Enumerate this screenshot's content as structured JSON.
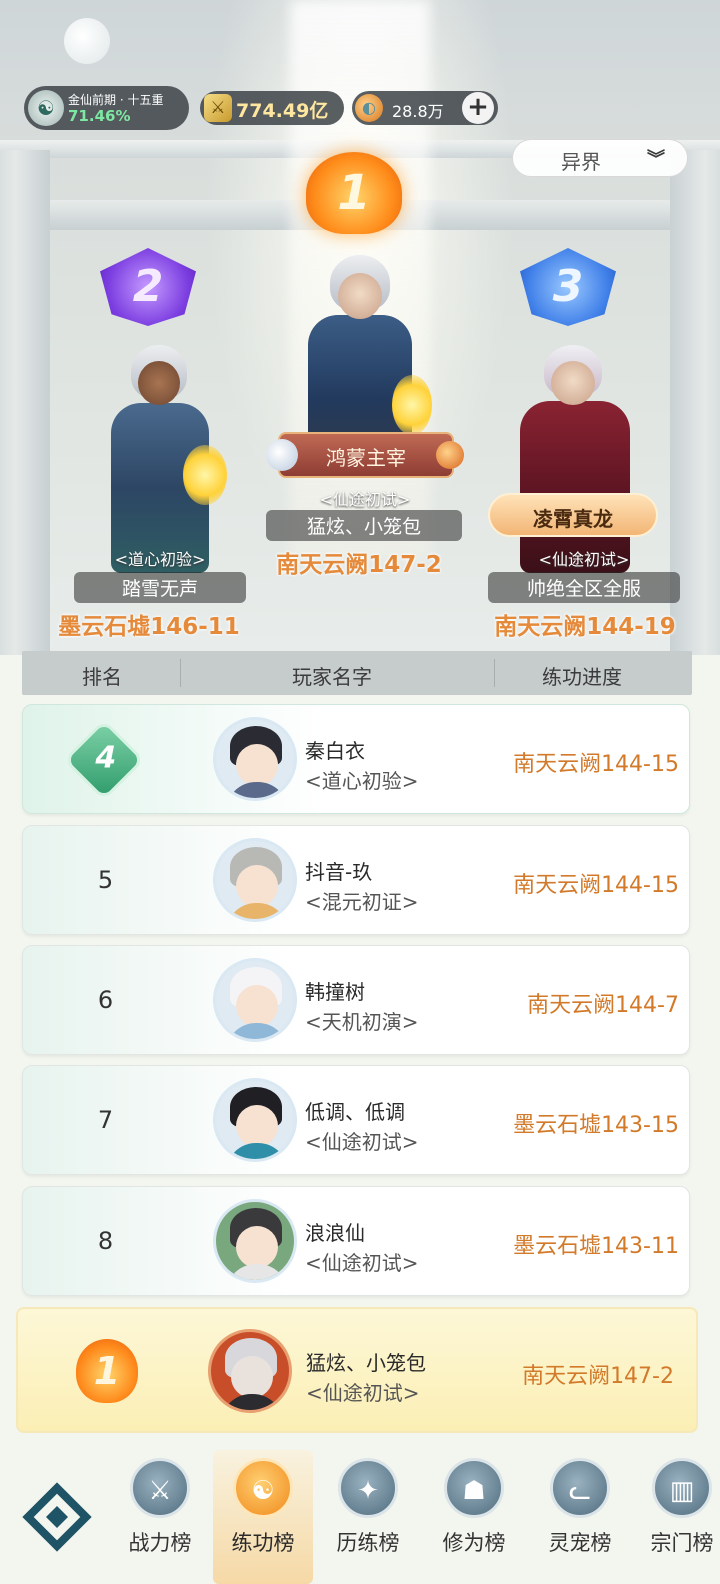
{
  "status_bar": {
    "realm_name": "金仙前期 · 十五重",
    "realm_progress": "71.46%",
    "power": "774.49亿",
    "currency": "28.8万",
    "add_label": "+"
  },
  "realm_select": {
    "value": "异界"
  },
  "podium": {
    "first": {
      "rank": "1",
      "title": "鸿蒙主宰",
      "tier": "<仙途初试>",
      "name": "猛炫、小笼包",
      "server": "南天云阙147-2"
    },
    "second": {
      "rank": "2",
      "tier": "<道心初验>",
      "name": "踏雪无声",
      "server": "墨云石墟146-11"
    },
    "third": {
      "rank": "3",
      "title": "凌霄真龙",
      "tier": "<仙途初试>",
      "name": "帅绝全区全服",
      "server": "南天云阙144-19"
    }
  },
  "table": {
    "headers": [
      "排名",
      "玩家名字",
      "练功进度"
    ],
    "rows": [
      {
        "rank": "4",
        "name": "秦白衣",
        "tier": "<道心初验>",
        "progress": "南天云阙144-15"
      },
      {
        "rank": "5",
        "name": "抖音-玖",
        "tier": "<混元初证>",
        "progress": "南天云阙144-15"
      },
      {
        "rank": "6",
        "name": "韩撞树",
        "tier": "<天机初演>",
        "progress": "南天云阙144-7"
      },
      {
        "rank": "7",
        "name": "低调、低调",
        "tier": "<仙途初试>",
        "progress": "墨云石墟143-15"
      },
      {
        "rank": "8",
        "name": "浪浪仙",
        "tier": "<仙途初试>",
        "progress": "墨云石墟143-11"
      }
    ]
  },
  "my_rank": {
    "rank": "1",
    "name": "猛炫、小笼包",
    "tier": "<仙途初试>",
    "progress": "南天云阙147-2"
  },
  "bottom_nav": [
    {
      "label": "战力榜",
      "active": false
    },
    {
      "label": "练功榜",
      "active": true
    },
    {
      "label": "历练榜",
      "active": false
    },
    {
      "label": "修为榜",
      "active": false
    },
    {
      "label": "灵宠榜",
      "active": false
    },
    {
      "label": "宗门榜",
      "active": false
    }
  ],
  "colors": {
    "accent_orange": "#d27a2a",
    "active_tab": "#f08a1c",
    "rank4_green": "#2f9c6c"
  }
}
